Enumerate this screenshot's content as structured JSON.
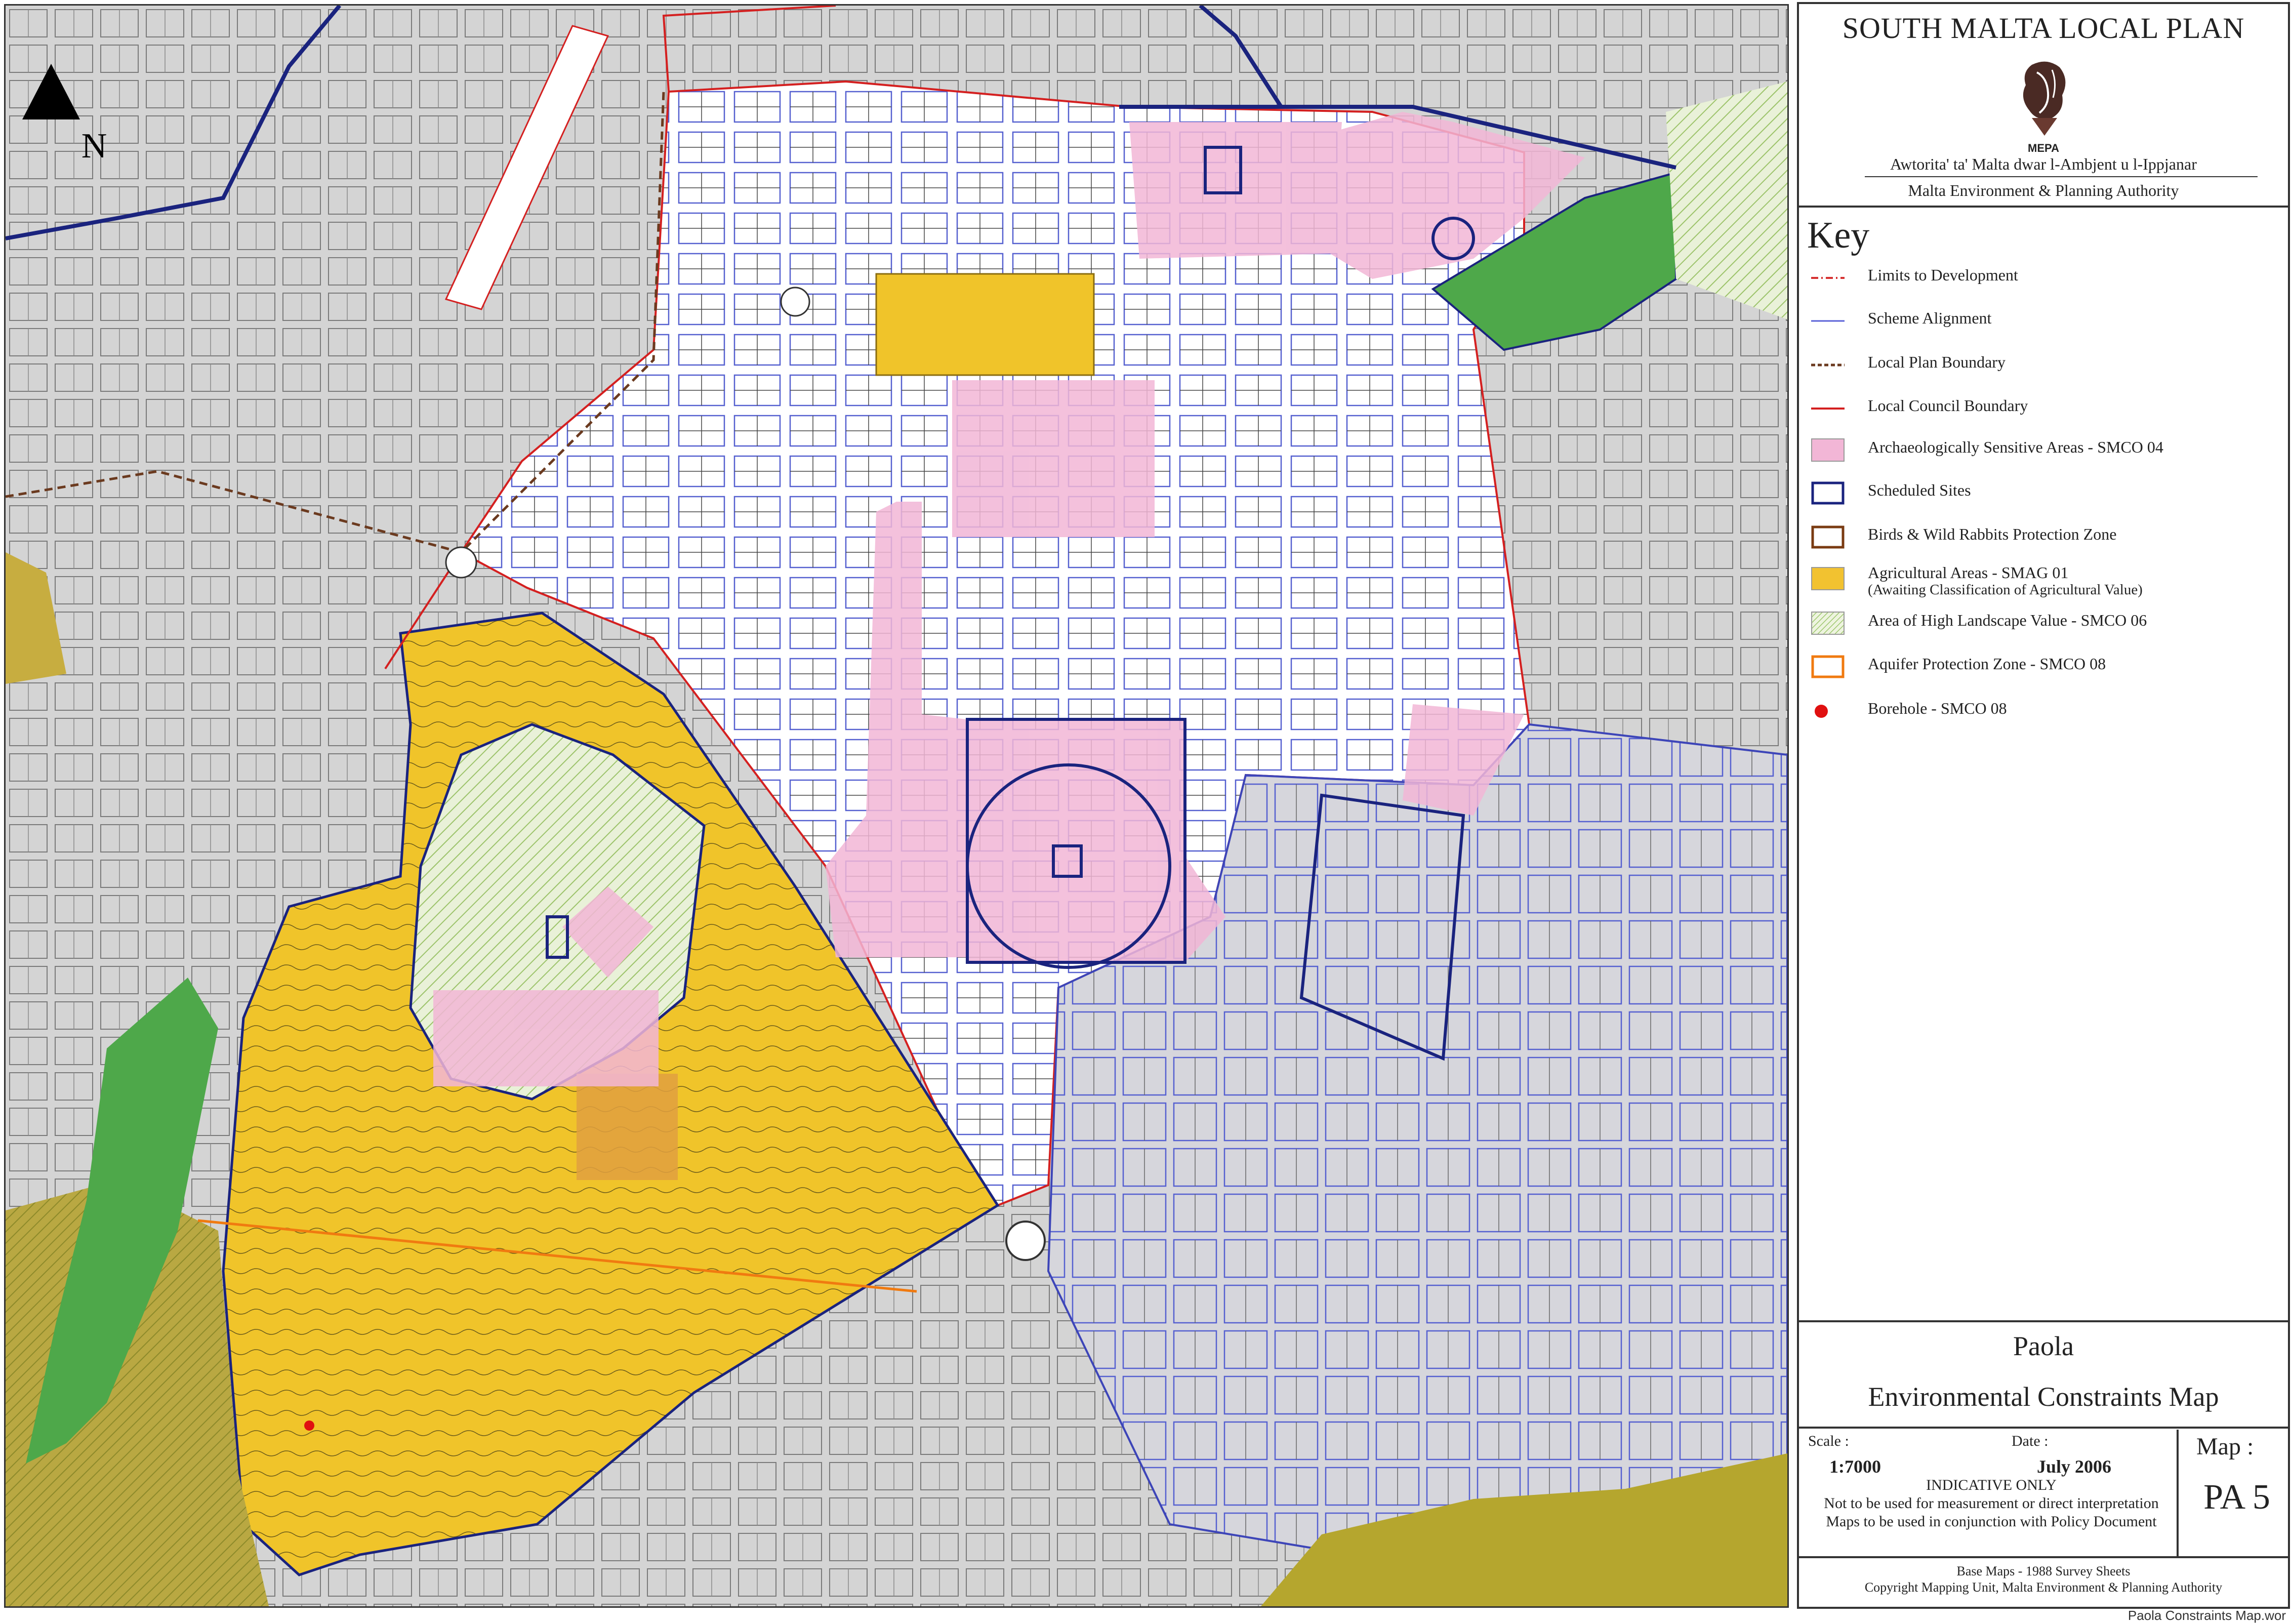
{
  "panel": {
    "title": "SOUTH MALTA LOCAL PLAN",
    "logo_text": "MEPA",
    "authority_mt": "Awtorita' ta' Malta dwar l-Ambjent u l-Ippjanar",
    "authority_en": "Malta Environment & Planning Authority",
    "key_title": "Key",
    "key_items": [
      {
        "label": "Limits to Development",
        "style": "dash-dot-line",
        "color": "#d63030"
      },
      {
        "label": "Scheme Alignment",
        "style": "line",
        "color": "#5a62d8"
      },
      {
        "label": "Local Plan Boundary",
        "style": "dashed-line",
        "color": "#6b3a1f"
      },
      {
        "label": "Local Council Boundary",
        "style": "line",
        "color": "#d42020"
      },
      {
        "label": "Archaeologically Sensitive Areas - SMCO 04",
        "style": "fill",
        "color": "#f2b6d6"
      },
      {
        "label": "Scheduled Sites",
        "style": "outline",
        "color": "#1a237e"
      },
      {
        "label": "Birds & Wild Rabbits Protection Zone",
        "style": "outline",
        "color": "#7a3b12"
      },
      {
        "label": "Agricultural Areas - SMAG 01",
        "label2": "(Awaiting Classification of Agricultural Value)",
        "style": "fill",
        "color": "#f2c230"
      },
      {
        "label": "Area of High Landscape Value - SMCO 06",
        "style": "hatch",
        "color": "#8fbf5a"
      },
      {
        "label": "Aquifer Protection Zone - SMCO 08",
        "style": "outline",
        "color": "#f07a10"
      },
      {
        "label": "Borehole - SMCO 08",
        "style": "dot",
        "color": "#e01010"
      }
    ],
    "locality": "Paola",
    "map_title": "Environmental Constraints Map",
    "scale_label": "Scale :",
    "scale_value": "1:7000",
    "date_label": "Date :",
    "date_value": "July 2006",
    "map_label": "Map :",
    "map_number": "PA 5",
    "note_1": "INDICATIVE ONLY",
    "note_2": "Not to be used for measurement or direct interpretation",
    "note_3": "Maps to be used in conjunction with Policy Document",
    "base_1": "Base Maps - 1988 Survey Sheets",
    "base_2": "Copyright Mapping Unit, Malta Environment & Planning Authority"
  },
  "map": {
    "north_label": "N",
    "base_color": "#d4d4d4",
    "urban_color": "#ffffff"
  },
  "file_name": "Paola Constraints Map.wor"
}
